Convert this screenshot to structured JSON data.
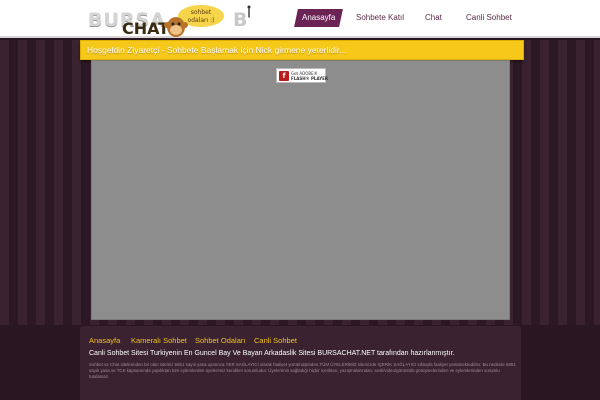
{
  "header": {
    "logo_text": "BURSA",
    "logo_chat": "CHAT",
    "logo_letter": "B",
    "bubble_text": "sohbet\nodaları :)"
  },
  "nav": {
    "items": [
      {
        "label": "Anasayfa",
        "active": true
      },
      {
        "label": "Sohbete Katıl",
        "active": false
      },
      {
        "label": "Chat",
        "active": false
      },
      {
        "label": "Canli Sohbet",
        "active": false
      }
    ]
  },
  "notice": {
    "text": "Hoşgeldin Ziyaretçi - Sohbete Başlamak için Nick girmene yeterlidir..."
  },
  "chat_panel": {
    "flash_badge": {
      "icon_letter": "f",
      "line1": "Get ADOBE®",
      "line2": "FLASH® PLAYER"
    }
  },
  "footer": {
    "links": [
      "Anasayfa",
      "Kameralı Sohbet",
      "Sohbet Odaları",
      "Canli Sohbet"
    ],
    "main_text": "Canli Sohbet Sitesi Turkiyenin En Guncel Bay Ve Bayan Arkadaslik Sitesi BURSACHAT.NET tarafından hazırlanmıştır.",
    "small_text": "Sohbet ve Chat sitelerinden bir olan sitemiz 5651 sayılı yasa uyarınca YER SAĞLAYICI olarak faaliyet yürütmüştinden,TÜM ÜYELERİMİZ sitemizde İÇERİK SAĞLAYICI sıfatıyla faaliyet yürütmektedirler. Bu nedenle 5651 sayılı yasa ve TCK kapsamında yapılıktan tüm eylemlerden üyelerimiz kendileri sorumludur. Üyelerimin sağladığı hiçbir içerikten, yazışmalarından, sesli/video/görüntülü görüşmelerinden ve eylemlerinden sorumlu tutulamaz."
  }
}
